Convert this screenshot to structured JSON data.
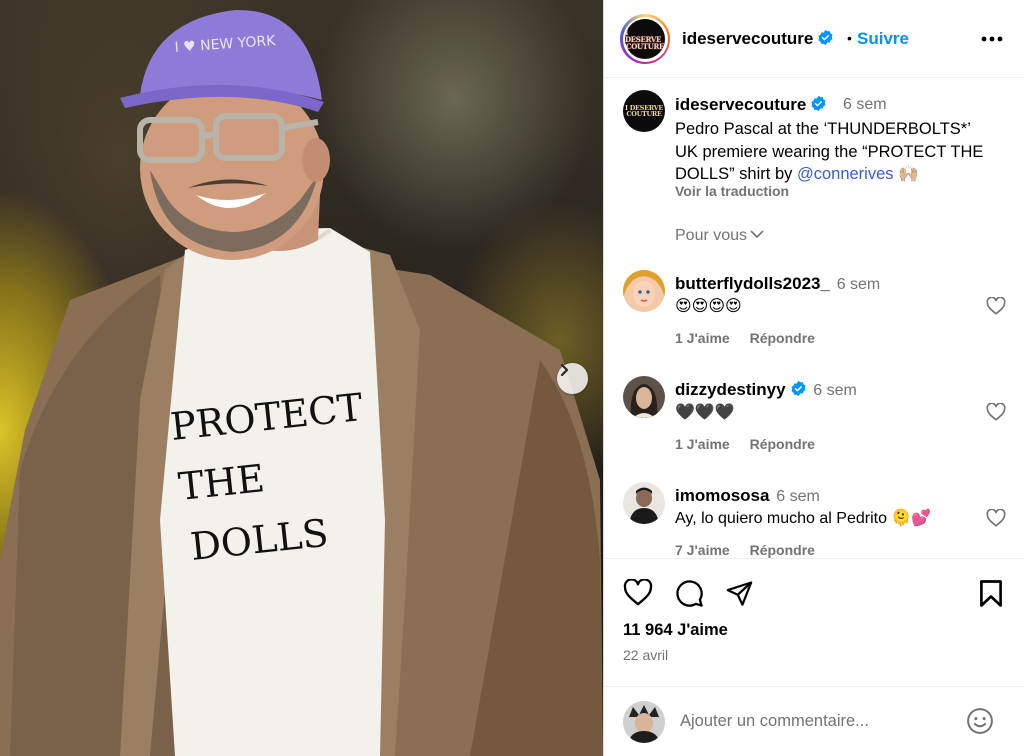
{
  "post": {
    "username": "ideservecouture",
    "follow_label": "Suivre",
    "dot": "•",
    "caption": {
      "time": "6 sem",
      "text": "Pedro Pascal at the ‘THUNDERBOLTS*’ UK premiere wearing the “PROTECT THE DOLLS” shirt by",
      "mention": "@connerives",
      "emoji": "🙌🏼",
      "translate_label": "Voir la traduction"
    },
    "logo_words": [
      "I DESERVE",
      "COUTURE"
    ],
    "for_you_label": "Pour vous",
    "shirt_lines": [
      "PROTECT",
      "THE",
      "DOLLS"
    ],
    "cap_text": "I ♥ NEW YORK"
  },
  "comments": [
    {
      "username": "butterflydolls2023_",
      "time": "6 sem",
      "text": "😍😍😍😍",
      "likes": "1 J'aime",
      "reply": "Répondre"
    },
    {
      "username": "dizzydestinyy",
      "time": "6 sem",
      "text": "🖤🖤🖤",
      "likes": "1 J'aime",
      "reply": "Répondre",
      "verified": true
    },
    {
      "username": "imomososa",
      "time": "6 sem",
      "text": "Ay, lo quiero mucho al Pedrito 🫠💕",
      "likes": "7 J'aime",
      "reply": "Répondre"
    }
  ],
  "stats": {
    "likes": "11 964 J'aime",
    "date": "22 avril"
  },
  "composer": {
    "placeholder": "Ajouter un commentaire..."
  },
  "colors": {
    "accent": "#0095f6",
    "verified": "#0095f6",
    "muted": "#737373"
  }
}
